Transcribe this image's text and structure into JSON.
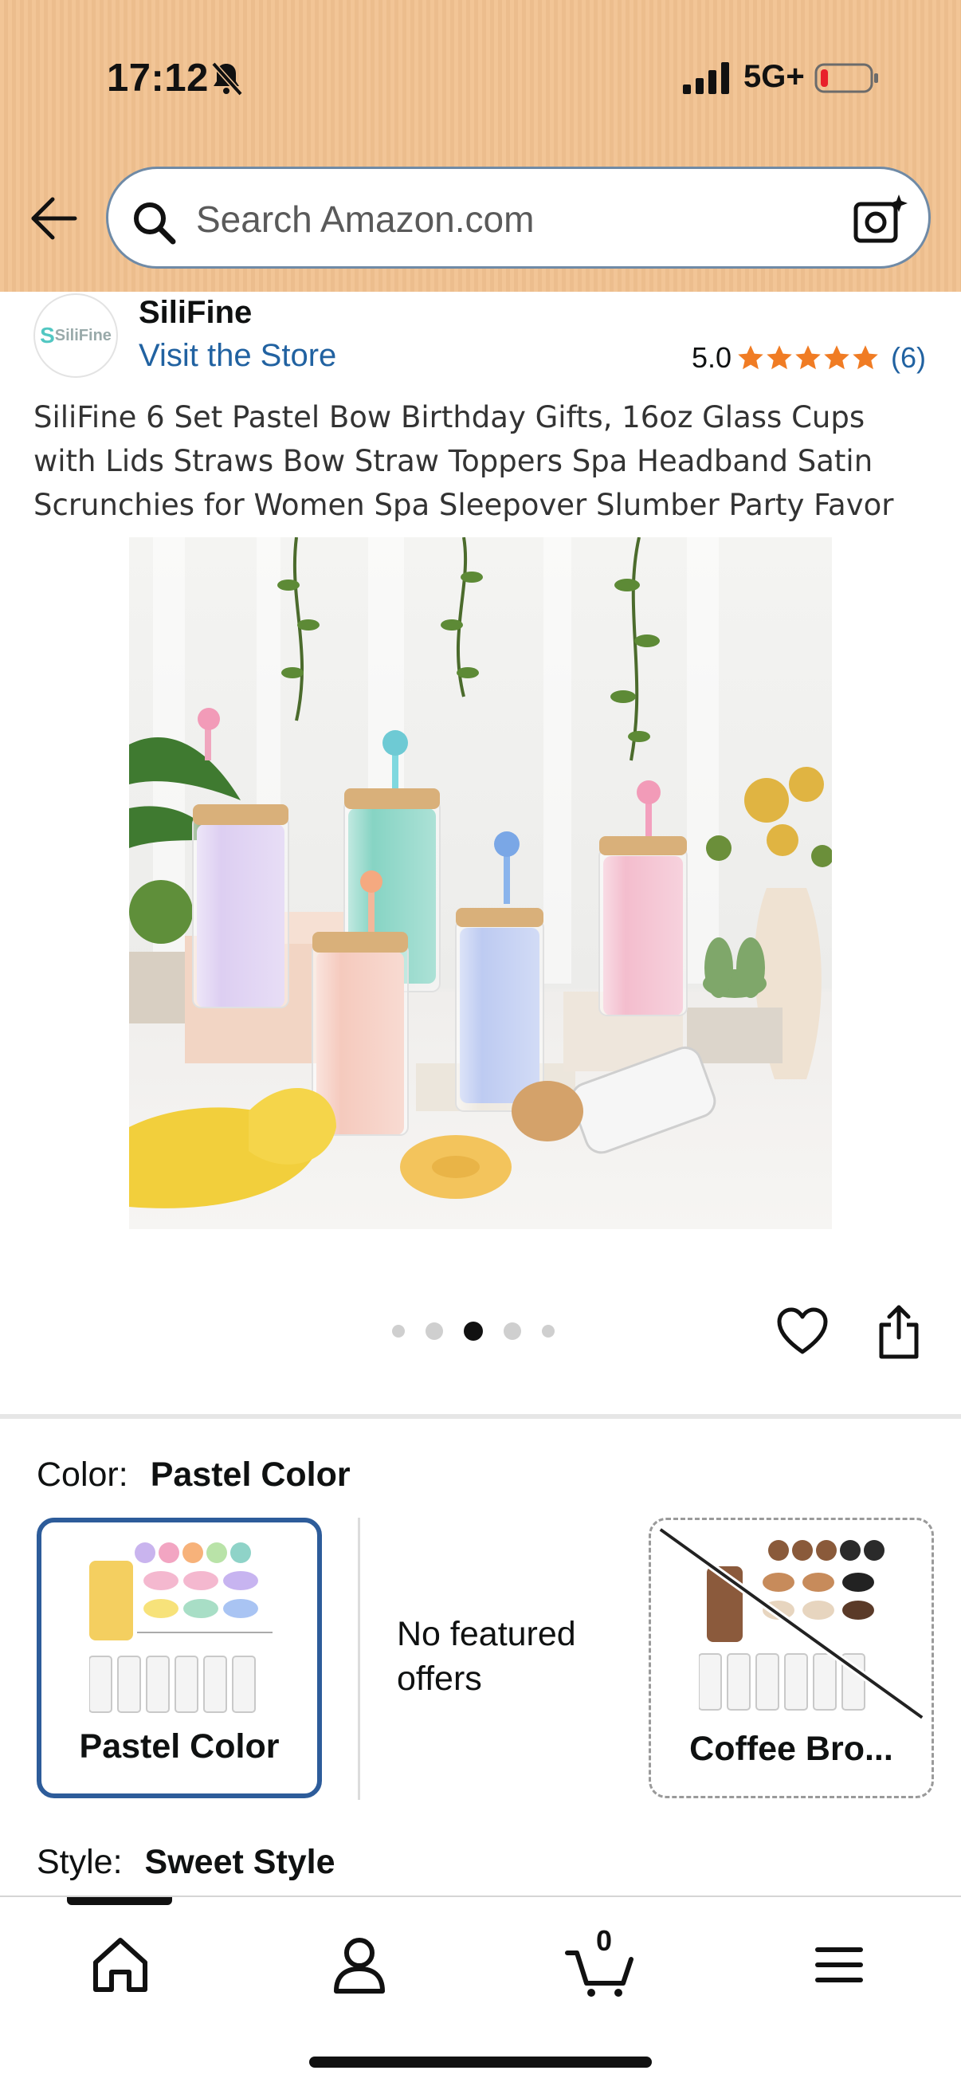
{
  "status_bar": {
    "time": "17:12",
    "network": "5G+"
  },
  "search": {
    "placeholder": "Search Amazon.com"
  },
  "brand": {
    "logo_text": "SiliFine",
    "name": "SiliFine",
    "visit_store": "Visit the Store"
  },
  "rating": {
    "value": "5.0",
    "stars": 5,
    "count": "(6)",
    "star_color": "#f07c24"
  },
  "product": {
    "title": "SiliFine 6 Set Pastel Bow Birthday Gifts, 16oz Glass Cups with Lids Straws Bow Straw Toppers Spa Headband Satin Scrunchies for Women Spa Sleepover Slumber Party Favor"
  },
  "carousel": {
    "total": 5,
    "active_index": 2
  },
  "color": {
    "label": "Color:",
    "selected_value": "Pastel Color",
    "options": [
      {
        "label": "Pastel Color",
        "state": "selected"
      },
      {
        "label": "No featured offers",
        "state": "info"
      },
      {
        "label": "Coffee Bro...",
        "state": "unavailable"
      }
    ]
  },
  "style": {
    "label": "Style:",
    "selected_value": "Sweet Style"
  },
  "bottom_nav": {
    "items": [
      "home-icon",
      "account-icon",
      "cart-icon",
      "menu-icon"
    ],
    "cart_count": "0"
  },
  "colors": {
    "header_bg": "#f2c596",
    "link_blue": "#2162a1",
    "selected_border": "#2d5c9a"
  }
}
